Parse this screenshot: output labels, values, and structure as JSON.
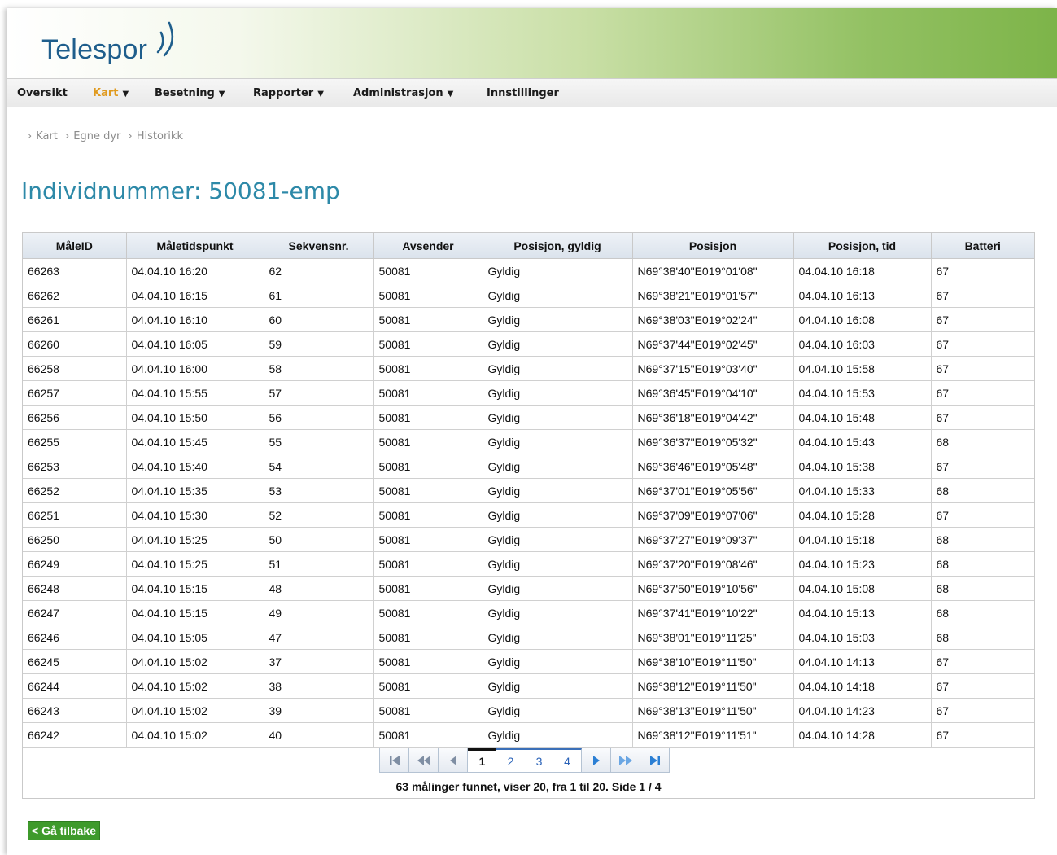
{
  "brand": {
    "name": "Telespor"
  },
  "nav": [
    {
      "label": "Oversikt",
      "active": false,
      "dropdown": false
    },
    {
      "label": "Kart",
      "active": true,
      "dropdown": true
    },
    {
      "label": "Besetning",
      "active": false,
      "dropdown": true
    },
    {
      "label": "Rapporter",
      "active": false,
      "dropdown": true
    },
    {
      "label": "Administrasjon",
      "active": false,
      "dropdown": true
    },
    {
      "label": "Innstillinger",
      "active": false,
      "dropdown": false
    }
  ],
  "breadcrumb": [
    "Kart",
    "Egne dyr",
    "Historikk"
  ],
  "page": {
    "title": "Individnummer: 50081-emp"
  },
  "table": {
    "columns": [
      "MåleID",
      "Måletidspunkt",
      "Sekvensnr.",
      "Avsender",
      "Posisjon, gyldig",
      "Posisjon",
      "Posisjon, tid",
      "Batteri"
    ],
    "rows": [
      [
        "66263",
        "04.04.10 16:20",
        "62",
        "50081",
        "Gyldig",
        "N69°38'40\"E019°01'08\"",
        "04.04.10 16:18",
        "67"
      ],
      [
        "66262",
        "04.04.10 16:15",
        "61",
        "50081",
        "Gyldig",
        "N69°38'21\"E019°01'57\"",
        "04.04.10 16:13",
        "67"
      ],
      [
        "66261",
        "04.04.10 16:10",
        "60",
        "50081",
        "Gyldig",
        "N69°38'03\"E019°02'24\"",
        "04.04.10 16:08",
        "67"
      ],
      [
        "66260",
        "04.04.10 16:05",
        "59",
        "50081",
        "Gyldig",
        "N69°37'44\"E019°02'45\"",
        "04.04.10 16:03",
        "67"
      ],
      [
        "66258",
        "04.04.10 16:00",
        "58",
        "50081",
        "Gyldig",
        "N69°37'15\"E019°03'40\"",
        "04.04.10 15:58",
        "67"
      ],
      [
        "66257",
        "04.04.10 15:55",
        "57",
        "50081",
        "Gyldig",
        "N69°36'45\"E019°04'10\"",
        "04.04.10 15:53",
        "67"
      ],
      [
        "66256",
        "04.04.10 15:50",
        "56",
        "50081",
        "Gyldig",
        "N69°36'18\"E019°04'42\"",
        "04.04.10 15:48",
        "67"
      ],
      [
        "66255",
        "04.04.10 15:45",
        "55",
        "50081",
        "Gyldig",
        "N69°36'37\"E019°05'32\"",
        "04.04.10 15:43",
        "68"
      ],
      [
        "66253",
        "04.04.10 15:40",
        "54",
        "50081",
        "Gyldig",
        "N69°36'46\"E019°05'48\"",
        "04.04.10 15:38",
        "67"
      ],
      [
        "66252",
        "04.04.10 15:35",
        "53",
        "50081",
        "Gyldig",
        "N69°37'01\"E019°05'56\"",
        "04.04.10 15:33",
        "68"
      ],
      [
        "66251",
        "04.04.10 15:30",
        "52",
        "50081",
        "Gyldig",
        "N69°37'09\"E019°07'06\"",
        "04.04.10 15:28",
        "67"
      ],
      [
        "66250",
        "04.04.10 15:25",
        "50",
        "50081",
        "Gyldig",
        "N69°37'27\"E019°09'37\"",
        "04.04.10 15:18",
        "68"
      ],
      [
        "66249",
        "04.04.10 15:25",
        "51",
        "50081",
        "Gyldig",
        "N69°37'20\"E019°08'46\"",
        "04.04.10 15:23",
        "68"
      ],
      [
        "66248",
        "04.04.10 15:15",
        "48",
        "50081",
        "Gyldig",
        "N69°37'50\"E019°10'56\"",
        "04.04.10 15:08",
        "68"
      ],
      [
        "66247",
        "04.04.10 15:15",
        "49",
        "50081",
        "Gyldig",
        "N69°37'41\"E019°10'22\"",
        "04.04.10 15:13",
        "68"
      ],
      [
        "66246",
        "04.04.10 15:05",
        "47",
        "50081",
        "Gyldig",
        "N69°38'01\"E019°11'25\"",
        "04.04.10 15:03",
        "68"
      ],
      [
        "66245",
        "04.04.10 15:02",
        "37",
        "50081",
        "Gyldig",
        "N69°38'10\"E019°11'50\"",
        "04.04.10 14:13",
        "67"
      ],
      [
        "66244",
        "04.04.10 15:02",
        "38",
        "50081",
        "Gyldig",
        "N69°38'12\"E019°11'50\"",
        "04.04.10 14:18",
        "67"
      ],
      [
        "66243",
        "04.04.10 15:02",
        "39",
        "50081",
        "Gyldig",
        "N69°38'13\"E019°11'50\"",
        "04.04.10 14:23",
        "67"
      ],
      [
        "66242",
        "04.04.10 15:02",
        "40",
        "50081",
        "Gyldig",
        "N69°38'12\"E019°11'51\"",
        "04.04.10 14:28",
        "67"
      ]
    ]
  },
  "pager": {
    "pages": [
      "1",
      "2",
      "3",
      "4"
    ],
    "current": "1",
    "controls": {
      "first": "first-page-icon",
      "prev_block": "rewind-icon",
      "prev": "previous-page-icon",
      "next": "next-page-icon",
      "next_block": "fast-forward-icon",
      "last": "last-page-icon"
    },
    "summary": "63 målinger funnet, viser 20, fra 1 til 20. Side 1 / 4"
  },
  "back_button": {
    "label": "< Gå tilbake"
  },
  "colors": {
    "title": "#2d89a8",
    "nav_active": "#e09a1e",
    "back_button": "#3e9a2b",
    "pager_link": "#2b63b8",
    "brand": "#1f5e8c"
  }
}
